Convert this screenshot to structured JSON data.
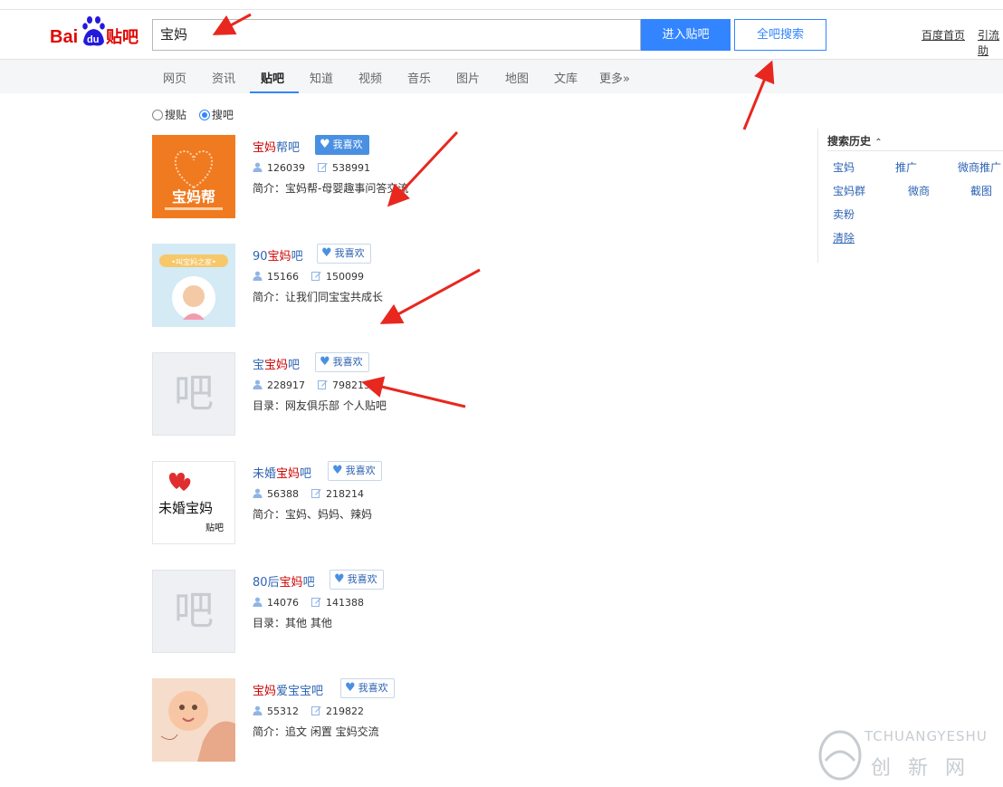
{
  "header": {
    "logo_text_bai": "Bai",
    "logo_text_du": "du",
    "logo_text_tieba": "贴吧",
    "search_value": "宝妈",
    "enter_button": "进入贴吧",
    "all_search_button": "全吧搜索",
    "links": [
      "百度首页",
      "引流助"
    ]
  },
  "nav": {
    "items": [
      "网页",
      "资讯",
      "贴吧",
      "知道",
      "视频",
      "音乐",
      "图片",
      "地图",
      "文库",
      "更多»"
    ],
    "active": "贴吧"
  },
  "search_mode": {
    "options": [
      "搜贴",
      "搜吧"
    ],
    "selected": "搜吧"
  },
  "results": [
    {
      "name_parts": [
        {
          "t": "宝妈",
          "hl": true
        },
        {
          "t": "帮吧",
          "hl": false
        }
      ],
      "like": "我喜欢",
      "like_active": true,
      "members": "126039",
      "posts": "538991",
      "desc": "简介：宝妈帮-母婴趣事问答交流",
      "thumb": "baomabang"
    },
    {
      "name_parts": [
        {
          "t": "90",
          "hl": false
        },
        {
          "t": "宝妈",
          "hl": true
        },
        {
          "t": "吧",
          "hl": false
        }
      ],
      "like": "我喜欢",
      "like_active": false,
      "members": "15166",
      "posts": "150099",
      "desc": "简介：让我们同宝宝共成长",
      "thumb": "baby-circle"
    },
    {
      "name_parts": [
        {
          "t": "宝",
          "hl": false
        },
        {
          "t": "宝妈",
          "hl": true
        },
        {
          "t": "吧",
          "hl": false
        }
      ],
      "like": "我喜欢",
      "like_active": false,
      "members": "228917",
      "posts": "798215",
      "desc": "目录：网友俱乐部   个人贴吧",
      "thumb": "placeholder"
    },
    {
      "name_parts": [
        {
          "t": "未婚",
          "hl": false
        },
        {
          "t": "宝妈",
          "hl": true
        },
        {
          "t": "吧",
          "hl": false
        }
      ],
      "like": "我喜欢",
      "like_active": false,
      "members": "56388",
      "posts": "218214",
      "desc": "简介：宝妈、妈妈、辣妈",
      "thumb": "weihun"
    },
    {
      "name_parts": [
        {
          "t": "80后",
          "hl": false
        },
        {
          "t": "宝妈",
          "hl": true
        },
        {
          "t": "吧",
          "hl": false
        }
      ],
      "like": "我喜欢",
      "like_active": false,
      "members": "14076",
      "posts": "141388",
      "desc": "目录：其他   其他",
      "thumb": "placeholder"
    },
    {
      "name_parts": [
        {
          "t": "宝妈",
          "hl": true
        },
        {
          "t": "爱宝宝吧",
          "hl": false
        }
      ],
      "like": "我喜欢",
      "like_active": false,
      "members": "55312",
      "posts": "219822",
      "desc": "简介：追文 闲置 宝妈交流",
      "thumb": "baby-photo"
    }
  ],
  "thumb_texts": {
    "baomabang": "宝妈帮",
    "baby_circle": "•叫宝妈之家•",
    "placeholder": "吧",
    "weihun_script": "未婚宝妈",
    "weihun_sign": "贴吧"
  },
  "history": {
    "title": "搜索历史",
    "collapse_glyph": "⌃",
    "links": [
      "宝妈",
      "推广",
      "微商推广",
      "宝妈群",
      "微商",
      "截图",
      "卖粉"
    ],
    "clear": "清除"
  },
  "watermark": {
    "top": "TCHUANGYESHU",
    "bottom": "创 新 网"
  },
  "colors": {
    "accent": "#3385ff",
    "link": "#2d64b3",
    "highlight": "#cc0000",
    "annotation_arrow": "#e8271f"
  }
}
